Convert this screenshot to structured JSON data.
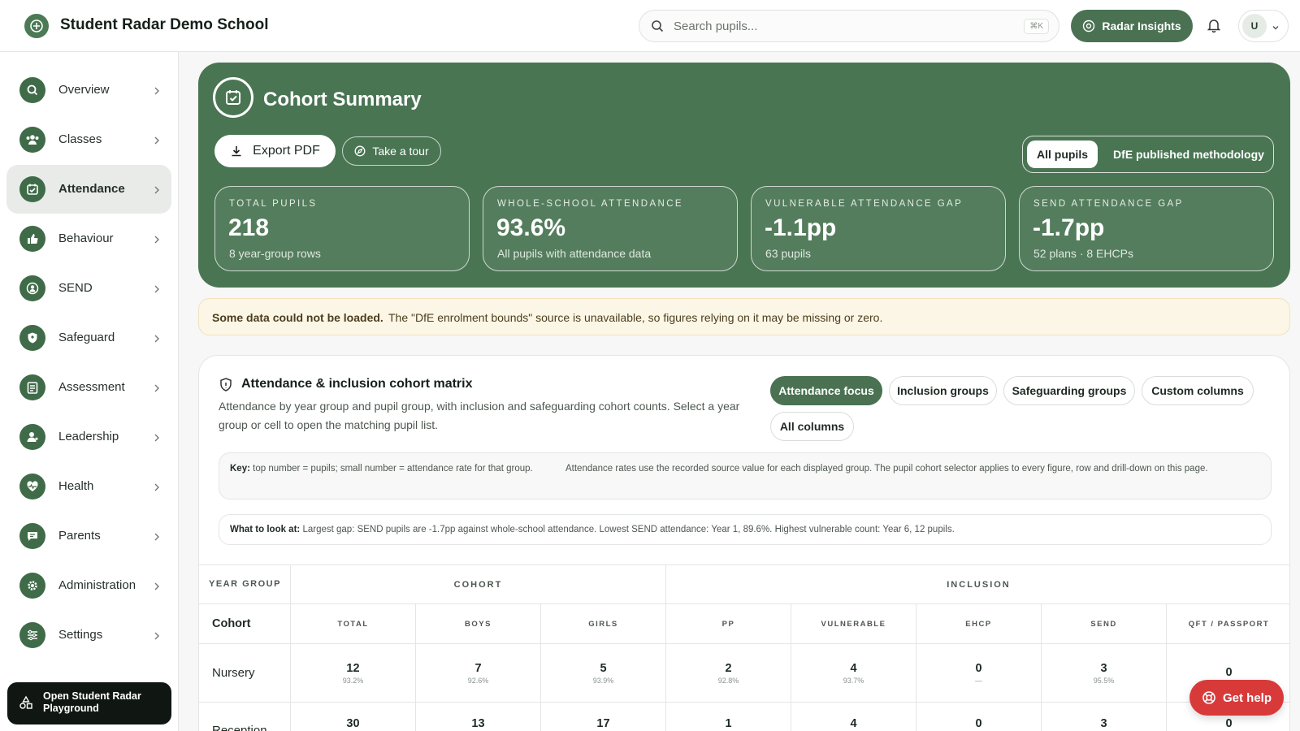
{
  "app": {
    "name": "Student Radar Demo School"
  },
  "search": {
    "placeholder": "Search pupils...",
    "shortcut": "⌘K"
  },
  "header": {
    "insights_label": "Radar Insights",
    "user_initial": "U"
  },
  "sidebar": {
    "items": [
      {
        "label": "Overview",
        "icon": "search-icon"
      },
      {
        "label": "Classes",
        "icon": "users-icon"
      },
      {
        "label": "Attendance",
        "icon": "calendar-check-icon",
        "active": true
      },
      {
        "label": "Behaviour",
        "icon": "thumbs-up-icon"
      },
      {
        "label": "SEND",
        "icon": "person-circle-icon"
      },
      {
        "label": "Safeguard",
        "icon": "shield-icon"
      },
      {
        "label": "Assessment",
        "icon": "clipboard-icon"
      },
      {
        "label": "Leadership",
        "icon": "person-star-icon"
      },
      {
        "label": "Health",
        "icon": "heart-pulse-icon"
      },
      {
        "label": "Parents",
        "icon": "chat-icon"
      },
      {
        "label": "Administration",
        "icon": "gear-icon"
      },
      {
        "label": "Settings",
        "icon": "sliders-icon"
      }
    ],
    "playground_label": "Open Student Radar Playground"
  },
  "hero": {
    "title": "Cohort Summary",
    "export_label": "Export PDF",
    "tour_label": "Take a tour",
    "segment": {
      "option1": "All pupils",
      "option2": "DfE published methodology",
      "selected": "All pupils"
    },
    "kpis": [
      {
        "label": "TOTAL PUPILS",
        "value": "218",
        "sub": "8 year-group rows"
      },
      {
        "label": "WHOLE-SCHOOL ATTENDANCE",
        "value": "93.6%",
        "sub": "All pupils with attendance data"
      },
      {
        "label": "VULNERABLE ATTENDANCE GAP",
        "value": "-1.1pp",
        "sub": "63 pupils"
      },
      {
        "label": "SEND ATTENDANCE GAP",
        "value": "-1.7pp",
        "sub": "52 plans · 8 EHCPs"
      }
    ]
  },
  "warning": {
    "bold": "Some data could not be loaded.",
    "text": "The \"DfE enrolment bounds\" source is unavailable, so figures relying on it may be missing or zero."
  },
  "matrix": {
    "title": "Attendance & inclusion cohort matrix",
    "description": "Attendance by year group and pupil group, with inclusion and safeguarding cohort counts. Select a year group or cell to open the matching pupil list.",
    "chips": [
      "Attendance focus",
      "Inclusion groups",
      "Safeguarding groups",
      "Custom columns",
      "All columns"
    ],
    "active_chip": "Attendance focus",
    "key_label": "Key:",
    "key_text": "top number = pupils; small number = attendance rate for that group.",
    "key_note": "Attendance rates use the recorded source value for each displayed group. The pupil cohort selector applies to every figure, row and drill-down on this page.",
    "look_label": "What to look at:",
    "look_text": "Largest gap: SEND pupils are -1.7pp against whole-school attendance. Lowest SEND attendance: Year 1, 89.6%. Highest vulnerable count: Year 6, 12 pupils.",
    "table": {
      "year_group_header": "YEAR GROUP",
      "group_headers": [
        "COHORT",
        "INCLUSION"
      ],
      "cohort_label": "Cohort",
      "columns": [
        "TOTAL",
        "BOYS",
        "GIRLS",
        "PP",
        "VULNERABLE",
        "EHCP",
        "SEND",
        "QFT / PASSPORT"
      ],
      "rows": [
        {
          "name": "Nursery",
          "cells": [
            {
              "n": "12",
              "r": "93.2%"
            },
            {
              "n": "7",
              "r": "92.6%"
            },
            {
              "n": "5",
              "r": "93.9%"
            },
            {
              "n": "2",
              "r": "92.8%"
            },
            {
              "n": "4",
              "r": "93.7%"
            },
            {
              "n": "0",
              "r": "—"
            },
            {
              "n": "3",
              "r": "95.5%"
            },
            {
              "n": "0",
              "r": ""
            }
          ]
        },
        {
          "name": "Reception",
          "cells": [
            {
              "n": "30",
              "r": ""
            },
            {
              "n": "13",
              "r": ""
            },
            {
              "n": "17",
              "r": ""
            },
            {
              "n": "1",
              "r": ""
            },
            {
              "n": "4",
              "r": ""
            },
            {
              "n": "0",
              "r": ""
            },
            {
              "n": "3",
              "r": ""
            },
            {
              "n": "0",
              "r": ""
            }
          ]
        }
      ]
    }
  },
  "help": {
    "label": "Get help"
  }
}
